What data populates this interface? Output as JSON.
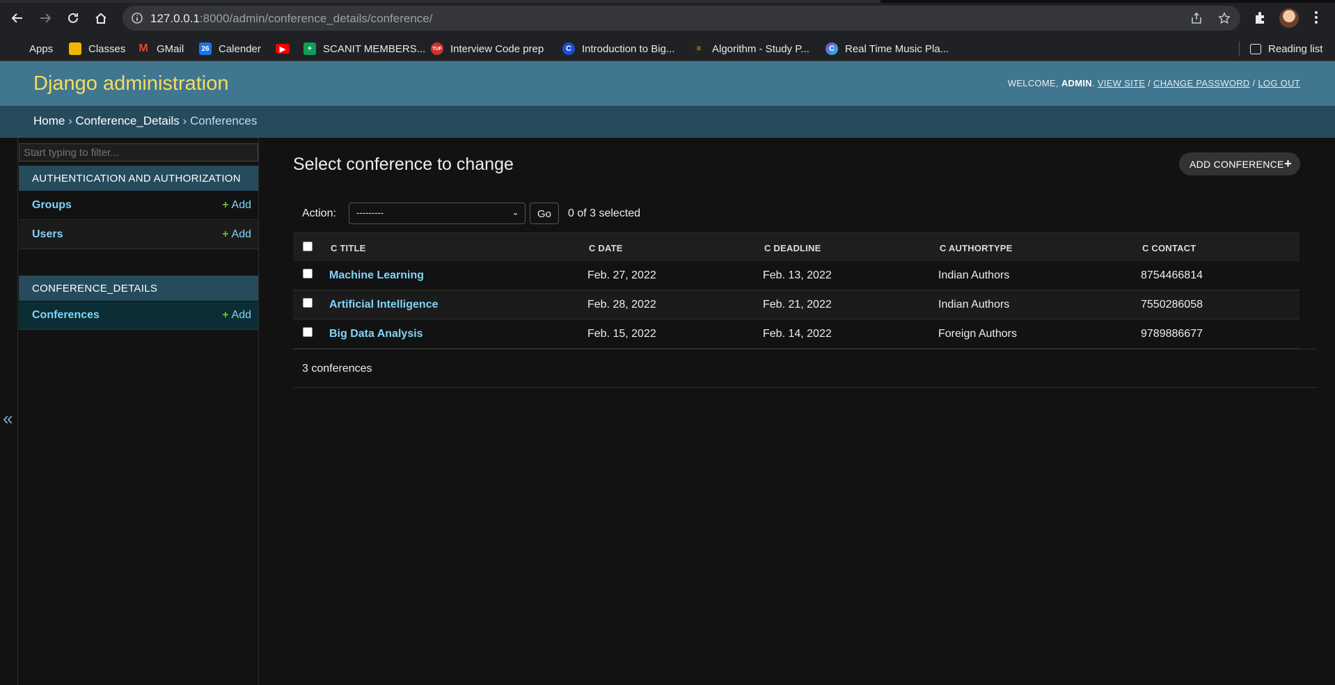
{
  "browser": {
    "url_host": "127.0.0.1",
    "url_rest": ":8000/admin/conference_details/conference/",
    "bookmarks": [
      "Apps",
      "Classes",
      "GMail",
      "Calender",
      "",
      "SCANIT MEMBERS...",
      "Interview Code prep",
      "Introduction to Big...",
      "Algorithm - Study P...",
      "Real Time Music Pla..."
    ],
    "reading_list": "Reading list",
    "calendar_icon_text": "26",
    "tuf_icon_text": "TUF",
    "c_icon_text": "C"
  },
  "header": {
    "branding": "Django administration",
    "welcome": "WELCOME,",
    "user": "ADMIN",
    "view_site": "VIEW SITE",
    "change_password": "CHANGE PASSWORD",
    "log_out": "LOG OUT",
    "sep": "/",
    "dot": "."
  },
  "breadcrumbs": {
    "home": "Home",
    "app": "Conference_Details",
    "model": "Conferences",
    "sep": "›"
  },
  "sidebar": {
    "toggle": "«",
    "filter_placeholder": "Start typing to filter...",
    "modules": [
      {
        "caption": "AUTHENTICATION AND AUTHORIZATION",
        "models": [
          {
            "name": "Groups",
            "add": "Add"
          },
          {
            "name": "Users",
            "add": "Add"
          }
        ]
      },
      {
        "caption": "CONFERENCE_DETAILS",
        "models": [
          {
            "name": "Conferences",
            "add": "Add"
          }
        ]
      }
    ]
  },
  "content": {
    "title": "Select conference to change",
    "add_button": "ADD CONFERENCE",
    "action_label": "Action:",
    "action_value": "---------",
    "go": "Go",
    "selected_count": "0 of 3 selected",
    "columns": [
      "C TITLE",
      "C DATE",
      "C DEADLINE",
      "C AUTHORTYPE",
      "C CONTACT"
    ],
    "rows": [
      [
        "Machine Learning",
        "Feb. 27, 2022",
        "Feb. 13, 2022",
        "Indian Authors",
        "8754466814"
      ],
      [
        "Artificial Intelligence",
        "Feb. 28, 2022",
        "Feb. 21, 2022",
        "Indian Authors",
        "7550286058"
      ],
      [
        "Big Data Analysis",
        "Feb. 15, 2022",
        "Feb. 14, 2022",
        "Foreign Authors",
        "9789886677"
      ]
    ],
    "paginator": "3 conferences"
  }
}
